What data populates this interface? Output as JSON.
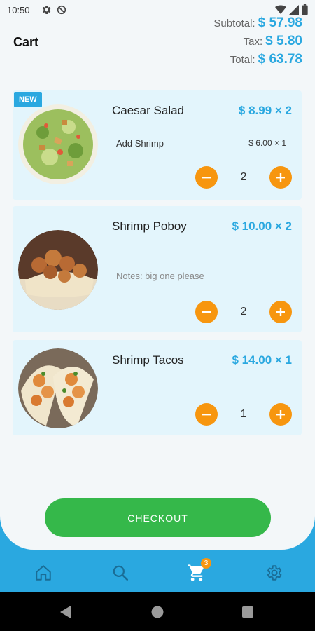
{
  "status_bar": {
    "time": "10:50"
  },
  "header": {
    "title": "Cart"
  },
  "totals": {
    "subtotal_label": "Subtotal:",
    "subtotal_value": "$ 57.98",
    "tax_label": "Tax:",
    "tax_value": "$ 5.80",
    "total_label": "Total:",
    "total_value": "$ 63.78"
  },
  "items": [
    {
      "badge": "NEW",
      "name": "Caesar Salad",
      "price": "$ 8.99 × 2",
      "addon": "Add Shrimp",
      "addon_price": "$ 6.00 × 1",
      "quantity": "2"
    },
    {
      "name": "Shrimp Poboy",
      "price": "$ 10.00 × 2",
      "notes": "Notes: big one please",
      "quantity": "2"
    },
    {
      "name": "Shrimp Tacos",
      "price": "$ 14.00 × 1",
      "quantity": "1"
    }
  ],
  "checkout": {
    "label": "CHECKOUT"
  },
  "nav": {
    "active": "cart",
    "cart_badge": "3"
  },
  "colors": {
    "accent": "#2aa8e0",
    "qty_button": "#f7960f",
    "checkout": "#35b84a"
  },
  "icons": [
    "gear-icon",
    "sync-off-icon",
    "wifi-icon",
    "signal-icon",
    "battery-icon",
    "home-icon",
    "search-icon",
    "cart-icon",
    "settings-icon",
    "back-icon",
    "home-circle-icon",
    "recents-icon"
  ]
}
